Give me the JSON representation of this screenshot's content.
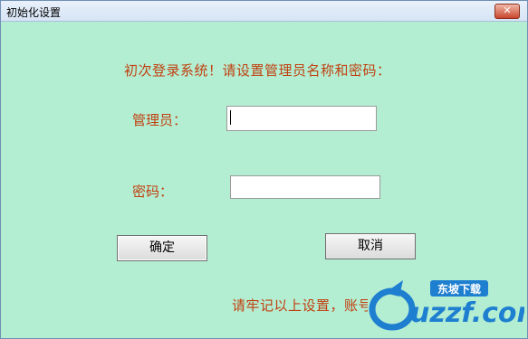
{
  "window": {
    "title": "初始化设置",
    "close_symbol": "✕"
  },
  "form": {
    "prompt": "初次登录系统！请设置管理员名称和密码：",
    "admin_label": "管理员：",
    "admin_value": "",
    "password_label": "密码：",
    "password_value": "",
    "ok_label": "确定",
    "cancel_label": "取消",
    "notice": "请牢记以上设置，账号"
  },
  "watermark": {
    "brand": "uzzf.com",
    "tag": "东坡下载"
  },
  "colors": {
    "background": "#b4eed2",
    "accent_text": "#c04010"
  }
}
